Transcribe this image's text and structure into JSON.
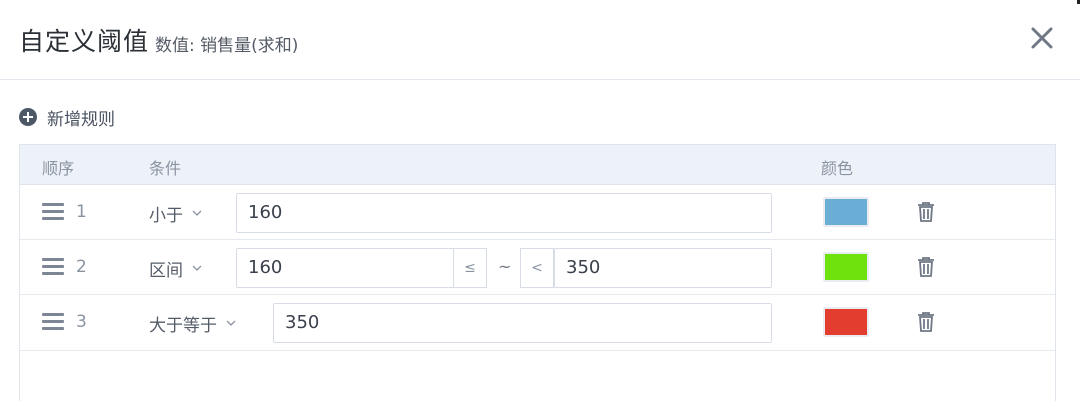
{
  "dialog": {
    "title": "自定义阈值",
    "subtitle": "数值: 销售量(求和)",
    "close_icon": "close-icon"
  },
  "toolbar": {
    "add_rule_label": "新增规则",
    "add_icon": "plus-circle-icon"
  },
  "table": {
    "headers": {
      "order": "顺序",
      "condition": "条件",
      "color": "颜色"
    },
    "rows": [
      {
        "order": "1",
        "condition": "小于",
        "value": "160",
        "color": "#6aaed6"
      },
      {
        "order": "2",
        "condition": "区间",
        "min": "160",
        "min_op": "≤",
        "separator": "~",
        "max_op": "<",
        "max": "350",
        "color": "#6ee20c"
      },
      {
        "order": "3",
        "condition": "大于等于",
        "value": "350",
        "color": "#e23d2f"
      }
    ]
  },
  "colors": {
    "header_bg": "#edf2f9",
    "border": "#dfe4ea",
    "text_muted": "#8a93a0"
  }
}
